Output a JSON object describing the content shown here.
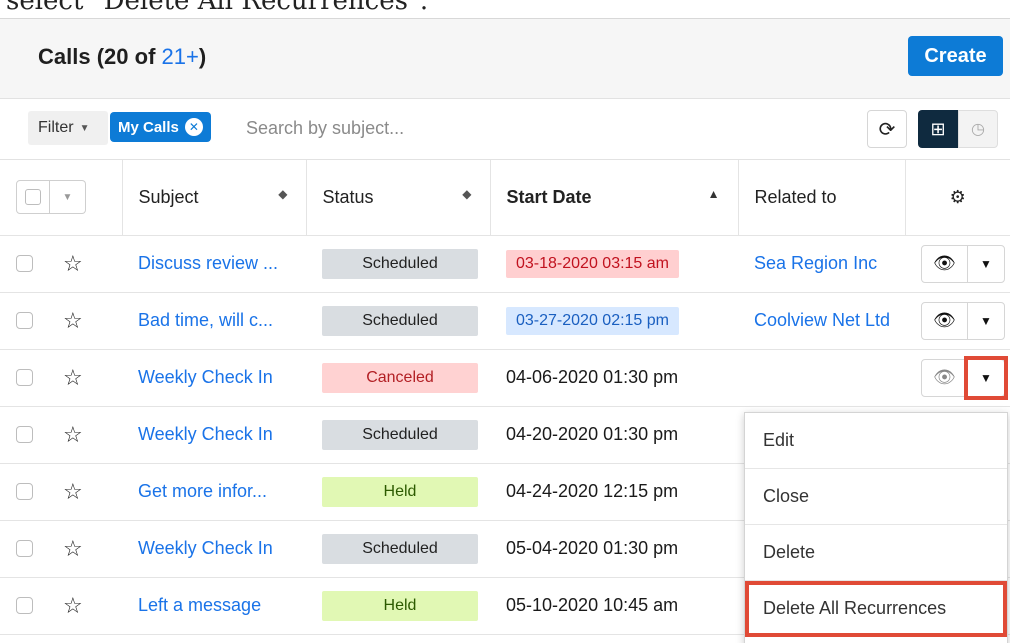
{
  "caption": "select \"Delete All Recurrences\".",
  "header": {
    "title": "Calls",
    "count_prefix": "(20 of ",
    "count_more": "21+",
    "count_suffix": ")",
    "create_label": "Create"
  },
  "filter": {
    "label": "Filter",
    "pill": "My Calls",
    "search_placeholder": "Search by subject..."
  },
  "columns": {
    "subject": "Subject",
    "status": "Status",
    "start_date": "Start Date",
    "related": "Related to"
  },
  "rows": [
    {
      "subject": "Discuss review ...",
      "status": "Scheduled",
      "date": "03-18-2020 03:15 am",
      "related": "Sea Region Inc"
    },
    {
      "subject": "Bad time, will c...",
      "status": "Scheduled",
      "date": "03-27-2020 02:15 pm",
      "related": "Coolview Net Ltd"
    },
    {
      "subject": "Weekly Check In",
      "status": "Canceled",
      "date": "04-06-2020 01:30 pm",
      "related": ""
    },
    {
      "subject": "Weekly Check In",
      "status": "Scheduled",
      "date": "04-20-2020 01:30 pm",
      "related": ""
    },
    {
      "subject": "Get more infor...",
      "status": "Held",
      "date": "04-24-2020 12:15 pm",
      "related": ""
    },
    {
      "subject": "Weekly Check In",
      "status": "Scheduled",
      "date": "05-04-2020 01:30 pm",
      "related": ""
    },
    {
      "subject": "Left a message",
      "status": "Held",
      "date": "05-10-2020 10:45 am",
      "related": ""
    }
  ],
  "menu": {
    "items": [
      "Edit",
      "Close",
      "Delete",
      "Delete All Recurrences"
    ]
  },
  "colors": {
    "accent": "#0d7bd6",
    "highlight": "#e04a36",
    "link": "#1a73e8"
  }
}
